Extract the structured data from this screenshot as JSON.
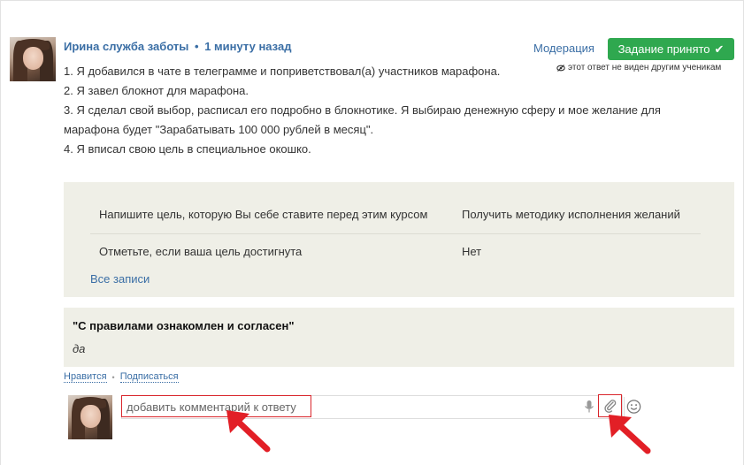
{
  "post": {
    "author": "Ирина служба заботы",
    "separator": "•",
    "time": "1 минуту назад",
    "moderation_label": "Модерация",
    "accepted_label": "Задание принято",
    "hidden_note": "этот ответ не виден другим ученикам",
    "body_lines": [
      "1. Я добавился в чате в телеграмме и поприветствовал(а) участников марафона.",
      "2. Я завел блокнот для марафона.",
      "3. Я сделал свой выбор, расписал его подробно в блокнотике. Я выбираю денежную сферу и мое желание для",
      "марафона будет \"Зарабатывать 100 000 рублей в месяц\".",
      "4. Я вписал свою цель в специальное окошко."
    ]
  },
  "fields": {
    "rows": [
      {
        "label": "Напишите цель, которую Вы себе ставите перед этим курсом",
        "value": "Получить методику исполнения желаний"
      },
      {
        "label": "Отметьте, если ваша цель достигнута",
        "value": "Нет"
      }
    ],
    "all_records_link": "Все записи"
  },
  "rules": {
    "title": "\"С правилами ознакомлен и согласен\"",
    "answer": "да"
  },
  "actions": {
    "like": "Нравится",
    "separator": "•",
    "subscribe": "Подписаться"
  },
  "comment": {
    "placeholder": "добавить комментарий к ответу"
  },
  "colors": {
    "link": "#3a6ea5",
    "accepted_button": "#2fa84f",
    "highlight": "#d9262c",
    "panel": "#efefe7"
  },
  "icons": {
    "accepted": "check-icon",
    "hidden": "eye-off-icon",
    "mic": "microphone-icon",
    "attach": "paperclip-icon",
    "emoji": "smiley-icon"
  }
}
